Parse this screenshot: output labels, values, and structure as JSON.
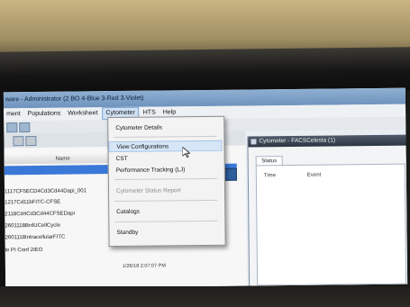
{
  "window": {
    "title": "ware - Administrator (2 BO 4-Blue 3-Red 3-Violet)"
  },
  "menubar": {
    "items": [
      "ment",
      "Populations",
      "Worksheet",
      "Cytometer",
      "HTS",
      "Help"
    ],
    "active": "Cytometer"
  },
  "left_panel": {
    "column_header": "Name",
    "selected_row": "e",
    "rows": [
      "1117CF5ECD4Cd3Cd44Dapi_001",
      "1217Cd11bFITC-CFSE",
      "2118Cd4Cd3Cd44CFSEDapi",
      "2601118BrdUCellCycle",
      "2601118IntracellularFITC",
      "le PI Conf 2IEO"
    ],
    "date": "1/26/18 2:07:07 PM"
  },
  "dropdown": {
    "items": [
      {
        "label": "Cytometer Details",
        "state": "normal"
      },
      {
        "label": "View Configurations",
        "state": "hover"
      },
      {
        "label": "CST",
        "state": "normal"
      },
      {
        "label": "Performance Tracking (LJ)",
        "state": "normal"
      },
      {
        "label": "Cytometer Status Report",
        "state": "disabled"
      },
      {
        "label": "Catalogs",
        "state": "normal"
      },
      {
        "label": "Standby",
        "state": "normal"
      }
    ]
  },
  "cytometer_window": {
    "title": "Cytometer - FACSCelesta (1)",
    "tab": "Status",
    "columns": [
      "Time",
      "Event"
    ]
  },
  "icons": {
    "cursor": "mouse-pointer-icon",
    "window": "window-icon",
    "action": "toolbar-action-icon"
  },
  "colors": {
    "selection": "#3a78d8",
    "menu_highlight": "#d6e6f6",
    "cyto_titlebar": "#2d3642"
  }
}
